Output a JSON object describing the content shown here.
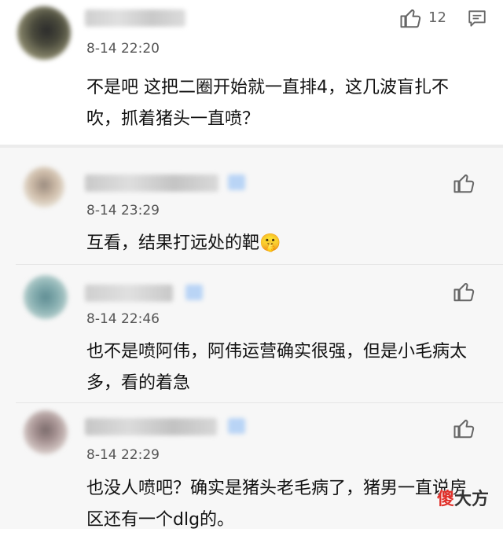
{
  "main": {
    "time": "8-14 22:20",
    "like_count": "12",
    "text": "不是吧  这把二圈开始就一直排4，这几波盲扎不吹，抓着猪头一直喷？"
  },
  "replies": [
    {
      "time": "8-14 23:29",
      "text": "互看，结果打远处的靶🤫"
    },
    {
      "time": "8-14 22:46",
      "text": "也不是喷阿伟，阿伟运营确实很强，但是小毛病太多，看的着急"
    },
    {
      "time": "8-14 22:29",
      "text": "也没人喷吧？确实是猪头老毛病了，猪男一直说房区还有一个dlg的。"
    }
  ],
  "watermark": {
    "char1": "傻",
    "rest": "大方"
  },
  "icons": {
    "like": "thumbs-up-icon",
    "reply": "comment-icon"
  }
}
